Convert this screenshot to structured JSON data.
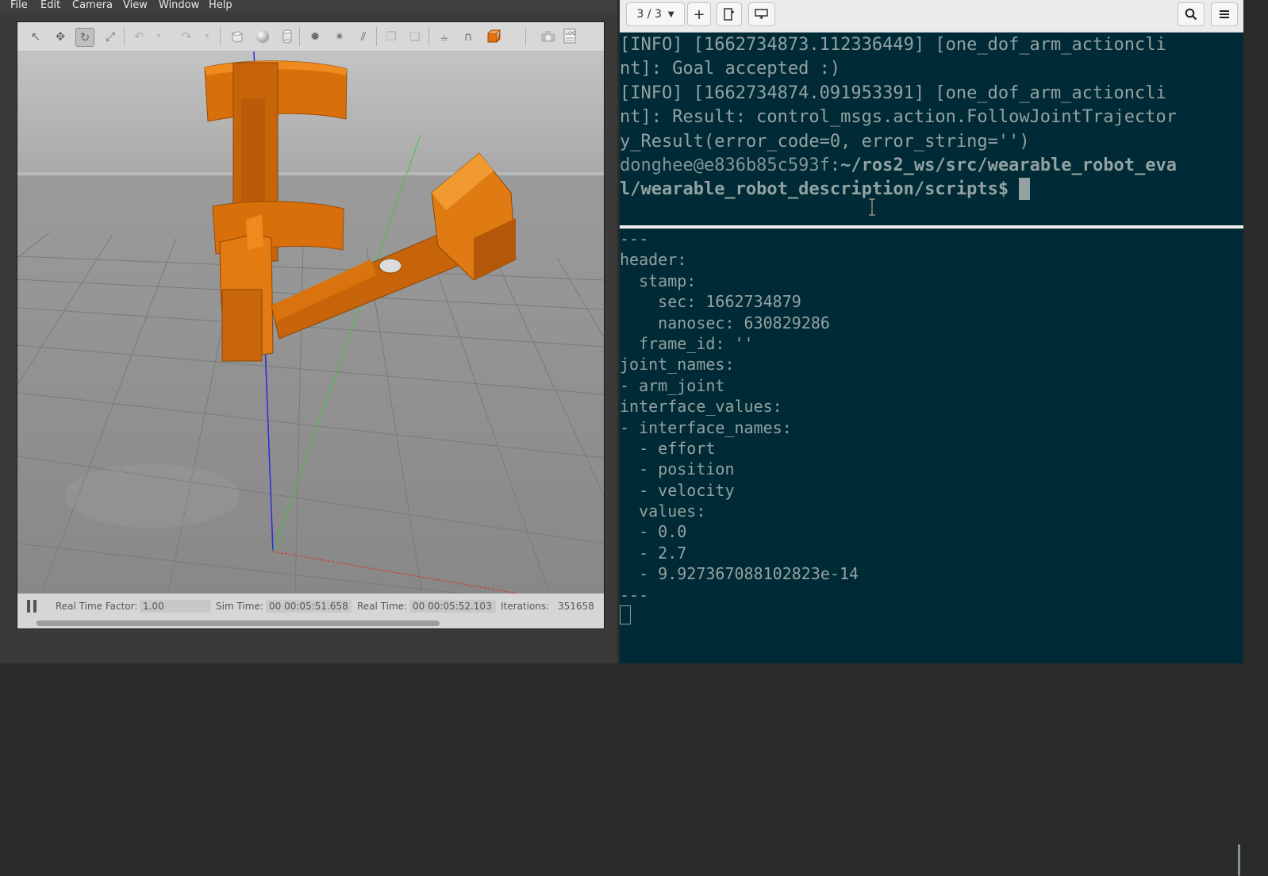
{
  "gazebo": {
    "menus": [
      "File",
      "Edit",
      "Camera",
      "View",
      "Window",
      "Help"
    ],
    "toolbar_icons": [
      "select-arrow-icon",
      "translate-icon",
      "rotate-icon",
      "scale-icon",
      "undo-icon",
      "undo-history-icon",
      "redo-icon",
      "redo-history-icon",
      "box-shape-icon",
      "sphere-shape-icon",
      "cylinder-shape-icon",
      "point-light-icon",
      "spot-light-icon",
      "directional-light-icon",
      "copy-icon",
      "paste-icon",
      "align-icon",
      "snap-magnet-icon",
      "view-angle-icon",
      "screenshot-camera-icon",
      "log-record-icon"
    ],
    "status": {
      "real_time_factor_label": "Real Time Factor:",
      "real_time_factor": "1.00",
      "sim_time_label": "Sim Time:",
      "sim_time": "00 00:05:51.658",
      "real_time_label": "Real Time:",
      "real_time": "00 00:05:52.103",
      "iterations_label": "Iterations:",
      "iterations": "351658"
    },
    "model_color": "#e07b0c"
  },
  "terminal": {
    "tab_counter": "3 / 3",
    "top_pane_lines": [
      "[INFO] [1662734873.112336449] [one_dof_arm_actioncli",
      "nt]: Goal accepted :)",
      "[INFO] [1662734874.091953391] [one_dof_arm_actioncli",
      "nt]: Result: control_msgs.action.FollowJointTrajector",
      "y_Result(error_code=0, error_string='')"
    ],
    "prompt_user": "donghee@e836b85c593f",
    "prompt_sep": ":",
    "prompt_path_1": "~/ros2_ws/src/wearable_robot_eva",
    "prompt_path_2": "l/wearable_robot_description/scripts",
    "prompt_end": "$ ",
    "bottom_pane_lines": [
      "---",
      "header:",
      "  stamp:",
      "    sec: 1662734879",
      "    nanosec: 630829286",
      "  frame_id: ''",
      "joint_names:",
      "- arm_joint",
      "interface_values:",
      "- interface_names:",
      "  - effort",
      "  - position",
      "  - velocity",
      "  values:",
      "  - 0.0",
      "  - 2.7",
      "  - 9.927367088102823e-14",
      "---"
    ],
    "background_color": "#002b36",
    "text_color": "#93a1a1"
  }
}
